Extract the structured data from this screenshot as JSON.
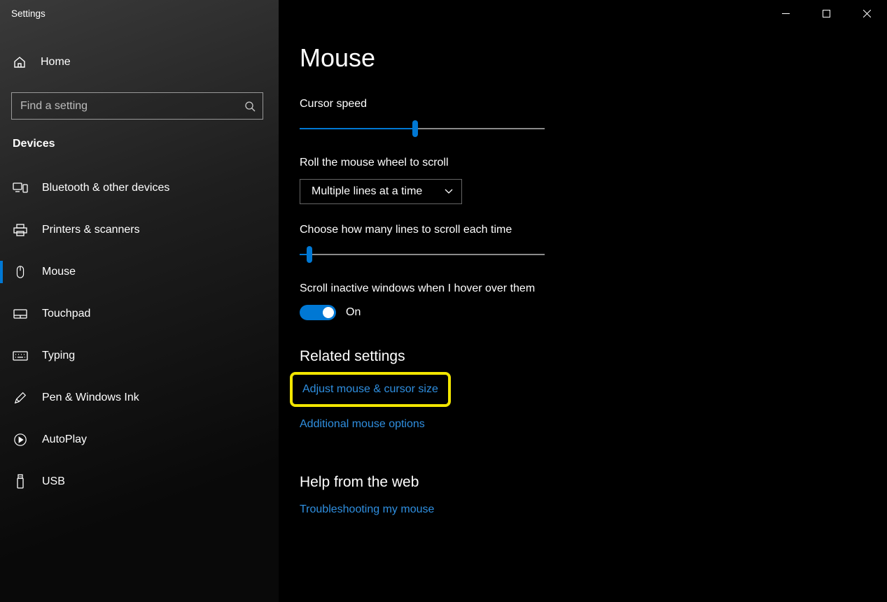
{
  "app_title": "Settings",
  "home_label": "Home",
  "search": {
    "placeholder": "Find a setting"
  },
  "category": "Devices",
  "nav": {
    "items": [
      {
        "label": "Bluetooth & other devices"
      },
      {
        "label": "Printers & scanners"
      },
      {
        "label": "Mouse"
      },
      {
        "label": "Touchpad"
      },
      {
        "label": "Typing"
      },
      {
        "label": "Pen & Windows Ink"
      },
      {
        "label": "AutoPlay"
      },
      {
        "label": "USB"
      }
    ]
  },
  "page_title": "Mouse",
  "cursor_speed": {
    "label": "Cursor speed",
    "percent": 47
  },
  "scroll_mode": {
    "label": "Roll the mouse wheel to scroll",
    "selected": "Multiple lines at a time"
  },
  "scroll_lines": {
    "label": "Choose how many lines to scroll each time",
    "percent": 4
  },
  "hover_scroll": {
    "label": "Scroll inactive windows when I hover over them",
    "state": "On"
  },
  "related": {
    "title": "Related settings",
    "link1": "Adjust mouse & cursor size",
    "link2": "Additional mouse options"
  },
  "help": {
    "title": "Help from the web",
    "link1": "Troubleshooting my mouse"
  }
}
